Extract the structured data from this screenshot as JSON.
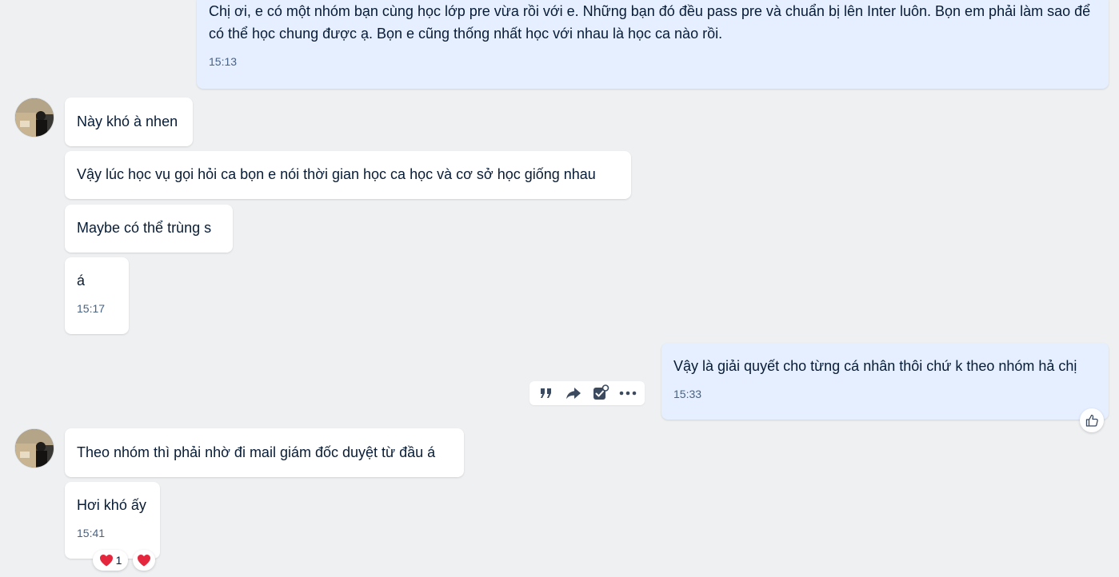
{
  "messages": [
    {
      "id": "m1",
      "direction": "out",
      "text": "Chị ơi, e có một nhóm bạn cùng học lớp pre vừa rồi với e. Những bạn đó đều pass pre và chuẩn bị lên Inter luôn. Bọn em phải làm sao để có thể học chung được ạ. Bọn e cũng thống nhất học với nhau là học ca nào rồi.",
      "time": "15:13"
    },
    {
      "id": "m2",
      "direction": "in",
      "text": "Này khó à nhen"
    },
    {
      "id": "m3",
      "direction": "in",
      "text": "Vậy lúc học vụ gọi hỏi ca bọn e nói thời gian học ca học và cơ sở học giống nhau"
    },
    {
      "id": "m4",
      "direction": "in",
      "text": "Maybe có thể trùng s"
    },
    {
      "id": "m5",
      "direction": "in",
      "text": "á",
      "time": "15:17"
    },
    {
      "id": "m6",
      "direction": "out",
      "text": "Vậy là giải quyết cho từng cá nhân thôi chứ k theo nhóm hả chị",
      "time": "15:33"
    },
    {
      "id": "m7",
      "direction": "in",
      "text": "Theo nhóm thì phải nhờ đi mail giám đốc duyệt từ đầu á"
    },
    {
      "id": "m8",
      "direction": "in",
      "text": "Hơi khó ấy",
      "time": "15:41"
    }
  ],
  "message_toolbar": {
    "icons": [
      "quote-icon",
      "share-icon",
      "task-icon",
      "more-icon"
    ]
  },
  "reactions": {
    "summary": {
      "emoji": "heart-icon",
      "count": "1"
    },
    "quick": {
      "emoji": "heart-icon"
    }
  },
  "colors": {
    "background": "#eef0f2",
    "incoming_bubble": "#ffffff",
    "outgoing_bubble": "#e5efff",
    "text": "#081c36",
    "time": "#476285",
    "heart": "#e5273e"
  }
}
